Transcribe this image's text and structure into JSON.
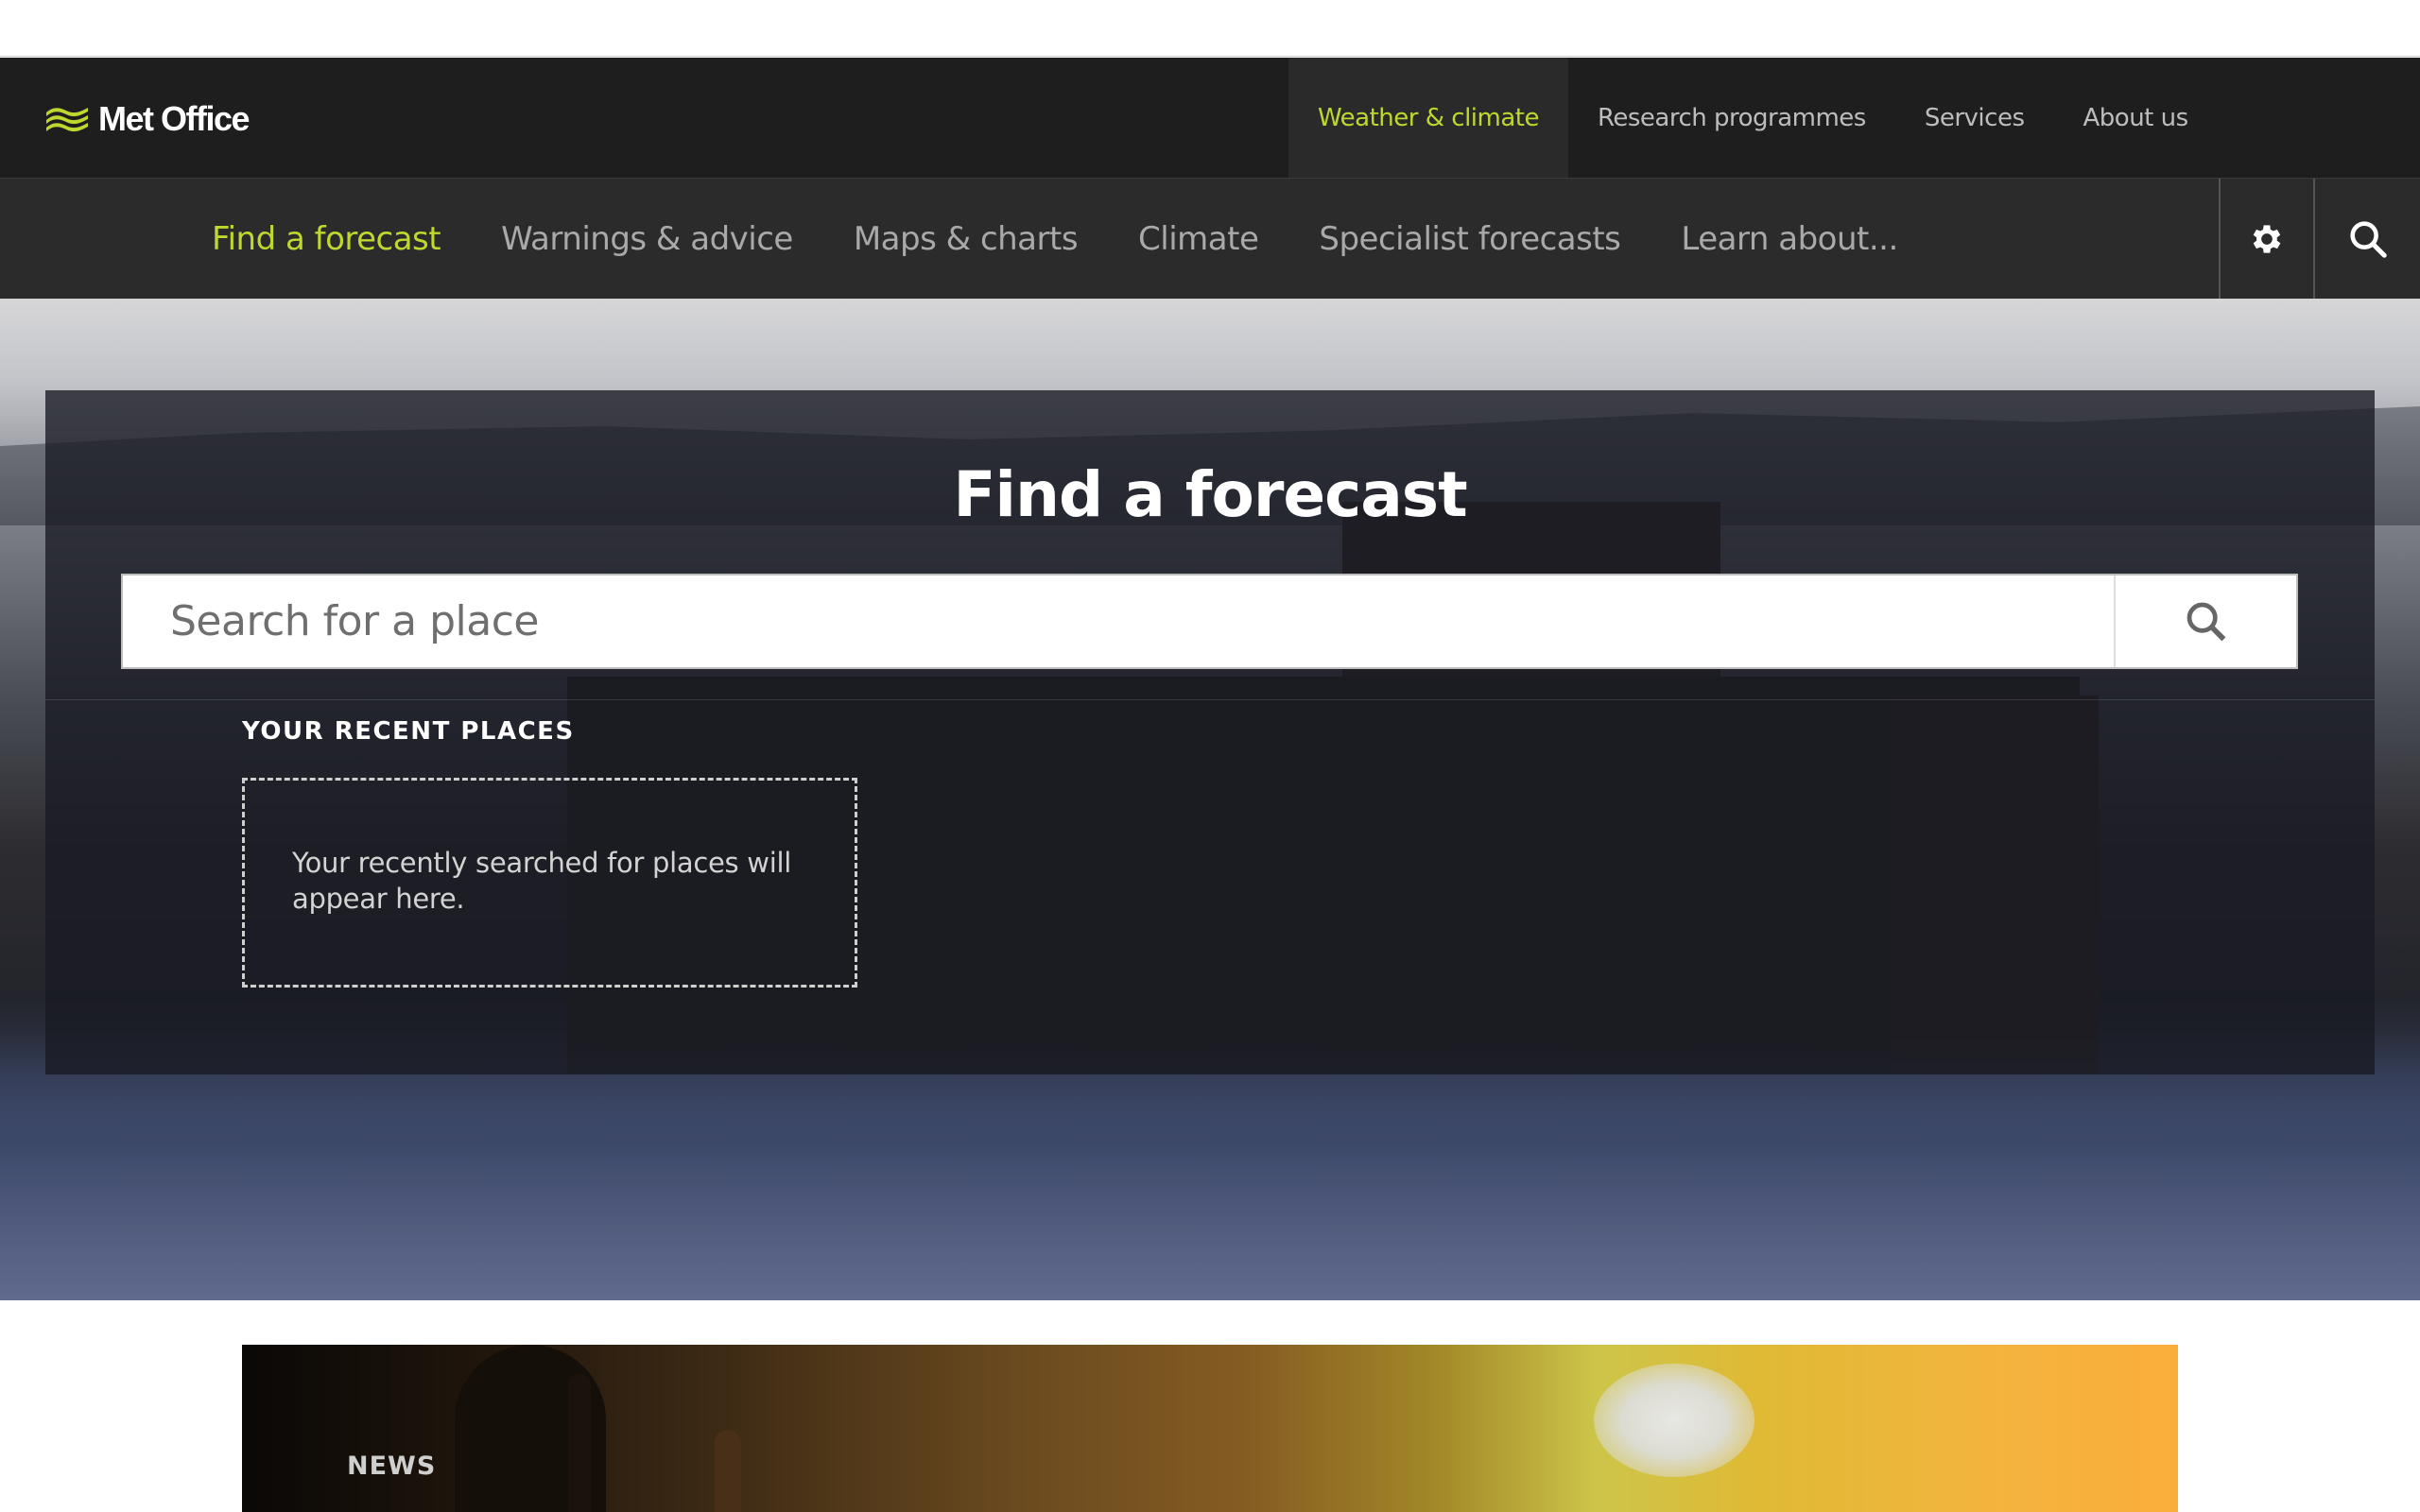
{
  "header": {
    "brand": "Met Office",
    "brand_color": "#c0d72f",
    "primary_nav": [
      {
        "label": "Weather & climate",
        "active": true
      },
      {
        "label": "Research programmes",
        "active": false
      },
      {
        "label": "Services",
        "active": false
      },
      {
        "label": "About us",
        "active": false
      }
    ],
    "secondary_nav": [
      {
        "label": "Find a forecast",
        "active": true
      },
      {
        "label": "Warnings & advice",
        "active": false
      },
      {
        "label": "Maps & charts",
        "active": false
      },
      {
        "label": "Climate",
        "active": false
      },
      {
        "label": "Specialist forecasts",
        "active": false
      },
      {
        "label": "Learn about...",
        "active": false
      }
    ],
    "icons": {
      "settings": "gear-icon",
      "search": "search-icon"
    }
  },
  "hero": {
    "title": "Find a forecast",
    "search": {
      "placeholder": "Search for a place",
      "value": "",
      "button_icon": "search-icon"
    },
    "recent": {
      "label": "YOUR RECENT PLACES",
      "empty_message": "Your recently searched for places will appear here."
    }
  },
  "news": {
    "label": "NEWS"
  }
}
